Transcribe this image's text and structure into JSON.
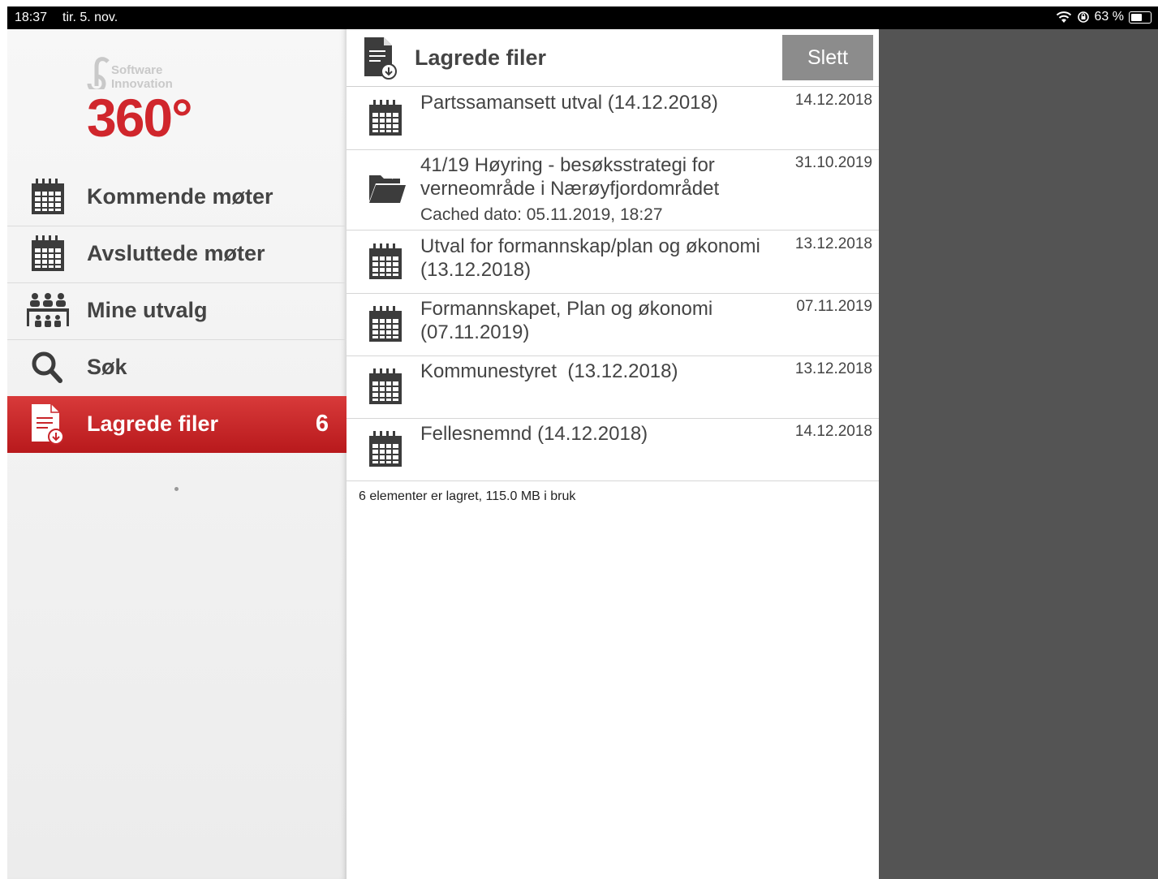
{
  "status_bar": {
    "time": "18:37",
    "date": "tir. 5. nov.",
    "battery": "63 %",
    "battery_level": 0.63,
    "icons": [
      "wifi-icon",
      "orientation-lock-icon",
      "battery-icon"
    ]
  },
  "logo": {
    "line1": "Software",
    "line2": "Innovation",
    "brand": "360°",
    "color": "#d0262c"
  },
  "sidebar": {
    "items": [
      {
        "label": "Kommende møter",
        "icon": "calendar-icon"
      },
      {
        "label": "Avsluttede møter",
        "icon": "calendar-icon"
      },
      {
        "label": "Mine utvalg",
        "icon": "committee-icon"
      },
      {
        "label": "Søk",
        "icon": "search-icon"
      },
      {
        "label": "Lagrede filer",
        "icon": "saved-file-icon",
        "count": "6",
        "active": true
      }
    ],
    "active_color": "#c8252a"
  },
  "main": {
    "title": "Lagrede filer",
    "delete_label": "Slett",
    "files": [
      {
        "title": "Partssamansett utval (14.12.2018)",
        "date": "14.12.2018",
        "icon": "calendar-icon"
      },
      {
        "title": "41/19 Høyring - besøksstrategi for verneområde i Nærøyfjordområdet",
        "date": "31.10.2019",
        "subtitle": "Cached dato: 05.11.2019, 18:27",
        "icon": "folder-icon"
      },
      {
        "title": "Utval for formannskap/plan og økonomi (13.12.2018)",
        "date": "13.12.2018",
        "icon": "calendar-icon"
      },
      {
        "title": "Formannskapet, Plan og økonomi (07.11.2019)",
        "date": "07.11.2019",
        "icon": "calendar-icon"
      },
      {
        "title": "Kommunestyret  (13.12.2018)",
        "date": "13.12.2018",
        "icon": "calendar-icon"
      },
      {
        "title": "Fellesnemnd (14.12.2018)",
        "date": "14.12.2018",
        "icon": "calendar-icon"
      }
    ],
    "footer": "6 elementer er lagret, 115.0 MB i bruk"
  }
}
